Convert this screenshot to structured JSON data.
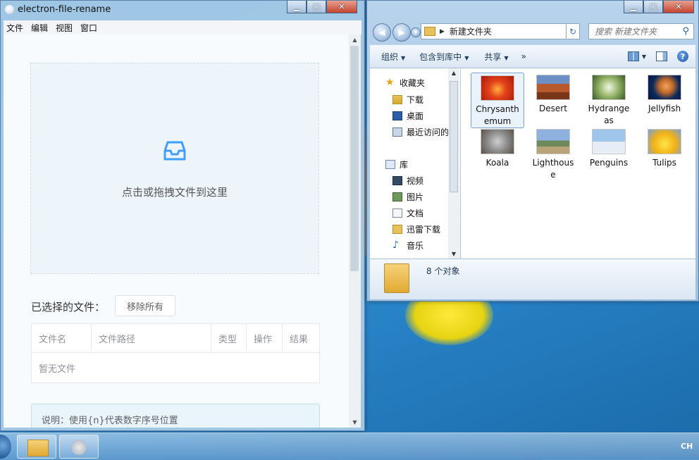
{
  "colors": {
    "accent": "#409eff",
    "desktop": "#1d6fb5"
  },
  "electron": {
    "title": "electron-file-rename",
    "menu": [
      "文件",
      "编辑",
      "视图",
      "窗口"
    ],
    "dropzone_text": "点击或拖拽文件到这里",
    "selected_label": "已选择的文件：",
    "remove_all": "移除所有",
    "table": {
      "columns": [
        "文件名",
        "文件路径",
        "类型",
        "操作",
        "结果"
      ],
      "empty_text": "暂无文件"
    },
    "note": "说明：使用{n}代表数字序号位置"
  },
  "explorer": {
    "address": "新建文件夹",
    "search_placeholder": "搜索 新建文件夹",
    "commands": [
      "组织",
      "包含到库中",
      "共享",
      "»"
    ],
    "nav": {
      "favorites": "收藏夹",
      "downloads": "下载",
      "desktop": "桌面",
      "recent": "最近访问的",
      "libraries": "库",
      "videos": "视频",
      "pictures": "图片",
      "documents": "文档",
      "thunder": "迅雷下载",
      "music": "音乐"
    },
    "files": [
      {
        "line1": "Chrysanth",
        "line2": "emum"
      },
      {
        "line1": "Desert",
        "line2": ""
      },
      {
        "line1": "Hydrange",
        "line2": "as"
      },
      {
        "line1": "Jellyfish",
        "line2": ""
      },
      {
        "line1": "Koala",
        "line2": ""
      },
      {
        "line1": "Lighthous",
        "line2": "e"
      },
      {
        "line1": "Penguins",
        "line2": ""
      },
      {
        "line1": "Tulips",
        "line2": ""
      }
    ],
    "status": "8 个对象"
  },
  "taskbar": {
    "tray_text": "CH"
  }
}
